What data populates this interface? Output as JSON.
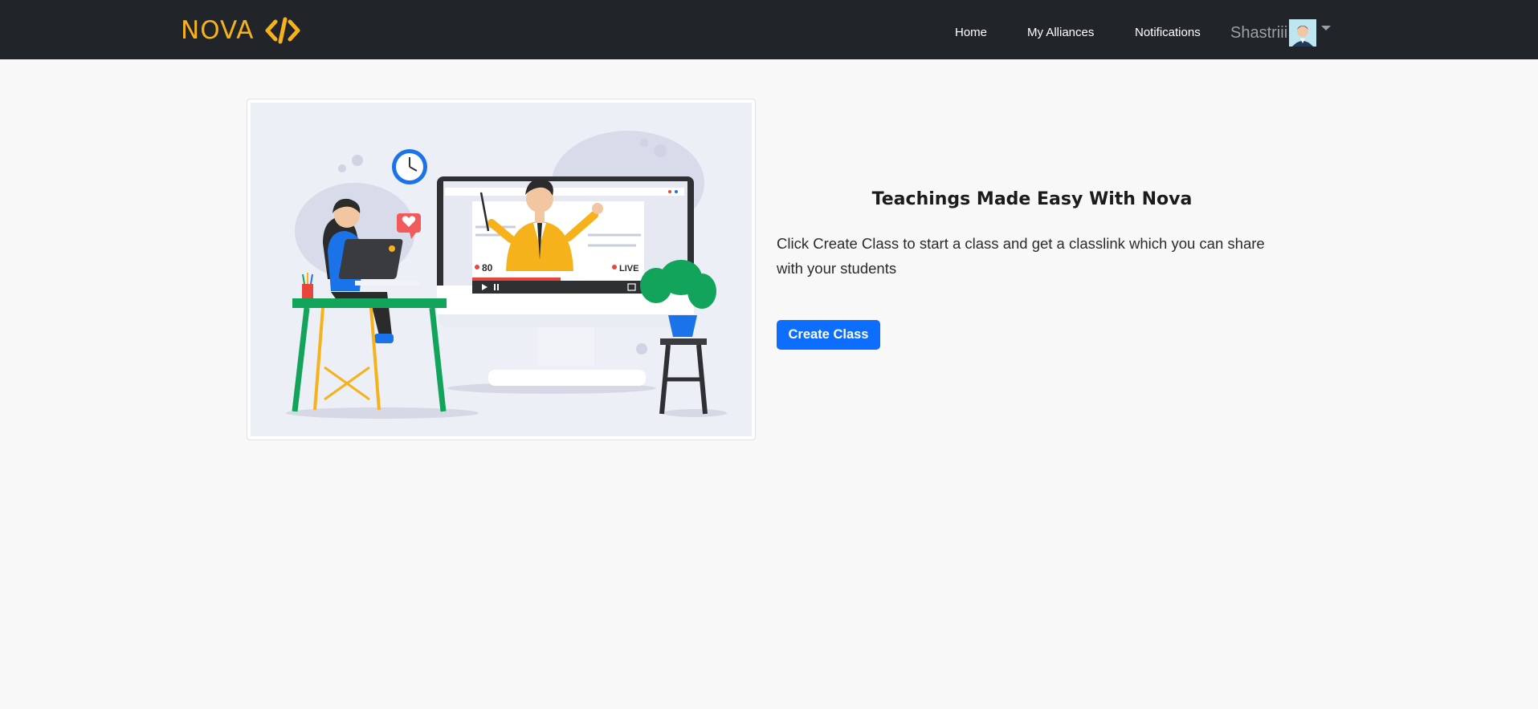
{
  "navbar": {
    "brand": "NOVA",
    "brand_icon": "code-brackets-icon",
    "links": [
      {
        "label": "Home"
      },
      {
        "label": "My Alliances"
      },
      {
        "label": "Notifications"
      }
    ],
    "user": {
      "name": "Shastriii",
      "avatar_icon": "user-avatar-icon",
      "menu_icon": "caret-down-icon"
    }
  },
  "hero": {
    "image_icon": "online-teaching-illustration",
    "badge_count": "80",
    "badge_live": "LIVE"
  },
  "main": {
    "heading": "Teachings Made Easy With Nova",
    "description": "Click Create Class to start a class and get a classlink which you can share with your students",
    "create_button": "Create Class"
  },
  "colors": {
    "navbar_bg": "#212529",
    "brand": "#f5b21b",
    "primary": "#0d6efd",
    "page_bg": "#f8f8f8"
  }
}
